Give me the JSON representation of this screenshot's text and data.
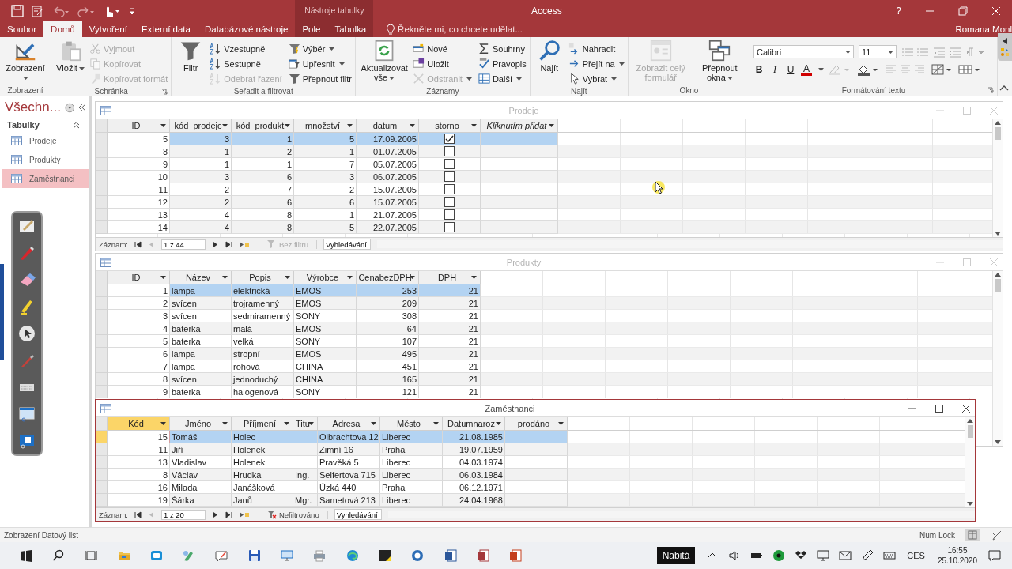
{
  "title_bar": {
    "context_label": "Nástroje tabulky",
    "app_title": "Access",
    "help": "?"
  },
  "ribbon_tabs": [
    {
      "label": "Soubor",
      "selected": false,
      "contextual": false
    },
    {
      "label": "Domů",
      "selected": true,
      "contextual": false
    },
    {
      "label": "Vytvoření",
      "selected": false,
      "contextual": false
    },
    {
      "label": "Externí data",
      "selected": false,
      "contextual": false
    },
    {
      "label": "Databázové nástroje",
      "selected": false,
      "contextual": false
    },
    {
      "label": "Pole",
      "selected": false,
      "contextual": true
    },
    {
      "label": "Tabulka",
      "selected": false,
      "contextual": true
    }
  ],
  "tell_me": "Řekněte mi, co chcete udělat...",
  "user": "Romana Monl",
  "ribbon_groups": [
    {
      "label": "Zobrazení",
      "launcher": false,
      "items": [
        {
          "kind": "large",
          "label": "Zobrazení",
          "dropdown": true,
          "disabled": false
        }
      ]
    },
    {
      "label": "Schránka",
      "launcher": true,
      "items": [
        {
          "kind": "large",
          "label": "Vložit",
          "dropdown": true,
          "disabled": false
        },
        {
          "kind": "small",
          "label": "Vyjmout",
          "dropdown": false,
          "disabled": true
        },
        {
          "kind": "small",
          "label": "Kopírovat",
          "dropdown": false,
          "disabled": true
        },
        {
          "kind": "small",
          "label": "Kopírovat formát",
          "dropdown": false,
          "disabled": true
        }
      ]
    },
    {
      "label": "Seřadit a filtrovat",
      "launcher": false,
      "items": [
        {
          "kind": "large",
          "label": "Filtr",
          "dropdown": false,
          "disabled": false
        },
        {
          "kind": "small",
          "label": "Vzestupně",
          "dropdown": false,
          "disabled": false
        },
        {
          "kind": "small",
          "label": "Sestupně",
          "dropdown": false,
          "disabled": false
        },
        {
          "kind": "small",
          "label": "Odebrat řazení",
          "dropdown": false,
          "disabled": true
        },
        {
          "kind": "small",
          "label": "Výběr",
          "dropdown": true,
          "disabled": false
        },
        {
          "kind": "small",
          "label": "Upřesnit",
          "dropdown": true,
          "disabled": false
        },
        {
          "kind": "small",
          "label": "Přepnout filtr",
          "dropdown": false,
          "disabled": false
        }
      ]
    },
    {
      "label": "Záznamy",
      "launcher": false,
      "items": [
        {
          "kind": "large",
          "label": "Aktualizovat vše",
          "dropdown": true,
          "disabled": false
        },
        {
          "kind": "small",
          "label": "Nové",
          "dropdown": false,
          "disabled": false
        },
        {
          "kind": "small",
          "label": "Uložit",
          "dropdown": false,
          "disabled": false
        },
        {
          "kind": "small",
          "label": "Odstranit",
          "dropdown": true,
          "disabled": true
        },
        {
          "kind": "small",
          "label": "Souhrny",
          "dropdown": false,
          "disabled": false
        },
        {
          "kind": "small",
          "label": "Pravopis",
          "dropdown": false,
          "disabled": false
        },
        {
          "kind": "small",
          "label": "Další",
          "dropdown": true,
          "disabled": false
        }
      ]
    },
    {
      "label": "Najít",
      "launcher": false,
      "items": [
        {
          "kind": "large",
          "label": "Najít",
          "dropdown": false,
          "disabled": false
        },
        {
          "kind": "small",
          "label": "Nahradit",
          "dropdown": false,
          "disabled": false
        },
        {
          "kind": "small",
          "label": "Přejít na",
          "dropdown": true,
          "disabled": false
        },
        {
          "kind": "small",
          "label": "Vybrat",
          "dropdown": true,
          "disabled": false
        }
      ]
    },
    {
      "label": "Okno",
      "launcher": false,
      "items": [
        {
          "kind": "large",
          "label": "Zobrazit celý formulář",
          "dropdown": false,
          "disabled": true
        },
        {
          "kind": "large",
          "label": "Přepnout okna",
          "dropdown": true,
          "disabled": false
        }
      ]
    }
  ],
  "format_group": {
    "label": "Formátování textu",
    "font": "Calibri",
    "size": "11",
    "buttons": [
      {
        "label": "B",
        "kind": "bold"
      },
      {
        "label": "I",
        "kind": "italic"
      },
      {
        "label": "U",
        "kind": "underline"
      },
      {
        "label": "A",
        "kind": "font-color"
      }
    ]
  },
  "nav_pane": {
    "title": "Všechn...",
    "section": "Tabulky",
    "items": [
      {
        "label": "Prodeje",
        "selected": false
      },
      {
        "label": "Produkty",
        "selected": false
      },
      {
        "label": "Zaměstnanci",
        "selected": true
      }
    ]
  },
  "windows": [
    {
      "title": "Prodeje",
      "active": false,
      "columns": [
        {
          "label": "ID",
          "kind": "number"
        },
        {
          "label": "kód_prodejc",
          "kind": "number"
        },
        {
          "label": "kód_produkt",
          "kind": "number"
        },
        {
          "label": "množství",
          "kind": "number"
        },
        {
          "label": "datum",
          "kind": "date"
        },
        {
          "label": "storno",
          "kind": "checkbox"
        },
        {
          "label": "Kliknutím přidat",
          "kind": "add"
        }
      ],
      "rows": [
        {
          "selected": true,
          "cells": [
            "5",
            "3",
            "1",
            "5",
            "17.09.2005",
            true
          ]
        },
        {
          "selected": false,
          "cells": [
            "8",
            "1",
            "2",
            "1",
            "01.07.2005",
            false
          ]
        },
        {
          "selected": false,
          "cells": [
            "9",
            "1",
            "1",
            "7",
            "05.07.2005",
            false
          ]
        },
        {
          "selected": false,
          "cells": [
            "10",
            "3",
            "6",
            "3",
            "06.07.2005",
            false
          ]
        },
        {
          "selected": false,
          "cells": [
            "11",
            "2",
            "7",
            "2",
            "15.07.2005",
            false
          ]
        },
        {
          "selected": false,
          "cells": [
            "12",
            "2",
            "6",
            "6",
            "15.07.2005",
            false
          ]
        },
        {
          "selected": false,
          "cells": [
            "13",
            "4",
            "8",
            "1",
            "21.07.2005",
            false
          ]
        },
        {
          "selected": false,
          "cells": [
            "14",
            "4",
            "8",
            "5",
            "22.07.2005",
            false
          ]
        }
      ],
      "nav": {
        "label": "Záznam:",
        "record": "1 z 44",
        "filter": "Bez filtru",
        "filter_disabled": true,
        "search": "Vyhledávání"
      }
    },
    {
      "title": "Produkty",
      "active": false,
      "columns": [
        {
          "label": "ID",
          "kind": "number"
        },
        {
          "label": "Název",
          "kind": "text"
        },
        {
          "label": "Popis",
          "kind": "text"
        },
        {
          "label": "Výrobce",
          "kind": "text"
        },
        {
          "label": "CenabezDPH",
          "kind": "number"
        },
        {
          "label": "DPH",
          "kind": "number"
        }
      ],
      "rows": [
        {
          "selected": true,
          "cells": [
            "1",
            "lampa",
            "elektrická",
            "EMOS",
            "253",
            "21"
          ]
        },
        {
          "selected": false,
          "cells": [
            "2",
            "svícen",
            "trojramenný",
            "EMOS",
            "209",
            "21"
          ]
        },
        {
          "selected": false,
          "cells": [
            "3",
            "svícen",
            "sedmiramenný",
            "SONY",
            "308",
            "21"
          ]
        },
        {
          "selected": false,
          "cells": [
            "4",
            "baterka",
            "malá",
            "EMOS",
            "64",
            "21"
          ]
        },
        {
          "selected": false,
          "cells": [
            "5",
            "baterka",
            "velká",
            "SONY",
            "107",
            "21"
          ]
        },
        {
          "selected": false,
          "cells": [
            "6",
            "lampa",
            "stropní",
            "EMOS",
            "495",
            "21"
          ]
        },
        {
          "selected": false,
          "cells": [
            "7",
            "lampa",
            "rohová",
            "CHINA",
            "451",
            "21"
          ]
        },
        {
          "selected": false,
          "cells": [
            "8",
            "svícen",
            "jednoduchý",
            "CHINA",
            "165",
            "21"
          ]
        },
        {
          "selected": false,
          "cells": [
            "9",
            "baterka",
            "halogenová",
            "SONY",
            "121",
            "21"
          ]
        }
      ]
    },
    {
      "title": "Zaměstnanci",
      "active": true,
      "columns": [
        {
          "label": "Kód",
          "kind": "number",
          "selected": true
        },
        {
          "label": "Jméno",
          "kind": "text",
          "selected": false
        },
        {
          "label": "Příjmení",
          "kind": "text",
          "selected": false
        },
        {
          "label": "Titu",
          "kind": "text",
          "selected": false
        },
        {
          "label": "Adresa",
          "kind": "text",
          "selected": false
        },
        {
          "label": "Město",
          "kind": "text",
          "selected": false
        },
        {
          "label": "Datumnaroz",
          "kind": "date",
          "selected": false
        },
        {
          "label": "prodáno",
          "kind": "text",
          "selected": false
        }
      ],
      "rows": [
        {
          "selected": true,
          "cells": [
            "15",
            "Tomáš",
            "Holec",
            null,
            "Olbrachtova 12",
            "Liberec",
            "21.08.1985",
            null
          ]
        },
        {
          "selected": false,
          "cells": [
            "11",
            "Jiří",
            "Holenek",
            null,
            "Zimní 16",
            "Praha",
            "19.07.1959",
            null
          ]
        },
        {
          "selected": false,
          "cells": [
            "13",
            "Vladislav",
            "Holenek",
            null,
            "Pravěká 5",
            "Liberec",
            "04.03.1974",
            null
          ]
        },
        {
          "selected": false,
          "cells": [
            "8",
            "Václav",
            "Hrudka",
            "Ing.",
            "Seifertova 715",
            "Liberec",
            "06.03.1984",
            null
          ]
        },
        {
          "selected": false,
          "cells": [
            "16",
            "Milada",
            "Janášková",
            null,
            "Úzká 440",
            "Praha",
            "06.12.1971",
            null
          ]
        },
        {
          "selected": false,
          "cells": [
            "19",
            "Šárka",
            "Janů",
            "Mgr.",
            "Sametová 213",
            "Liberec",
            "24.04.1968",
            null
          ]
        }
      ],
      "nav": {
        "label": "Záznam:",
        "record": "1 z 20",
        "filter": "Nefiltrováno",
        "filter_disabled": false,
        "search": "Vyhledávání"
      }
    }
  ],
  "status_bar": {
    "left": "Zobrazení Datový list",
    "right": "Num Lock"
  },
  "taskbar": {
    "tooltip": "Nabitá",
    "language": "CES",
    "time": "16:55",
    "date": "25.10.2020"
  }
}
